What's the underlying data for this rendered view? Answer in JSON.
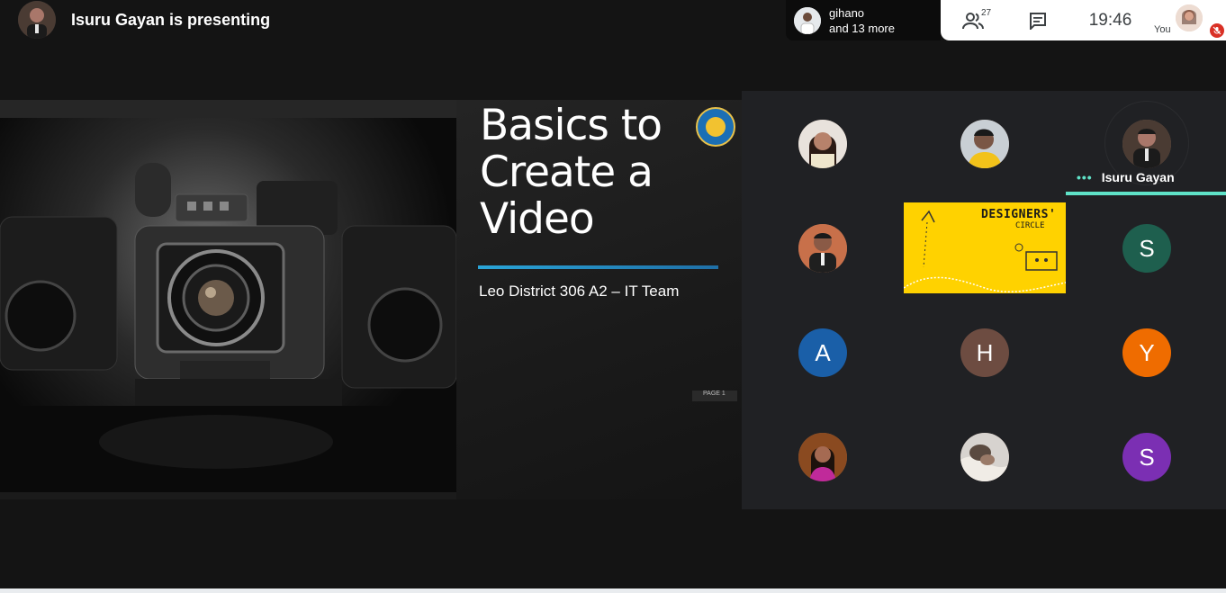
{
  "presenter": {
    "title": "Isuru Gayan is presenting"
  },
  "viewers": {
    "line1": "gihano",
    "line2": "and 13 more"
  },
  "controls": {
    "people_count": "27",
    "clock": "19:46",
    "self_label": "You"
  },
  "slide": {
    "title": "Basics to Create a Video",
    "subtitle": "Leo District 306 A2 – IT Team",
    "page": "PAGE 1"
  },
  "participants": {
    "active_speaker": "Isuru Gayan",
    "tile_designers_title": "DESIGNERS'",
    "tile_designers_sub": "CIRCLE",
    "initials": [
      "S",
      "A",
      "H",
      "Y",
      "S"
    ]
  },
  "colors": {
    "speaker_accent": "#5fe3c8",
    "initial_S_green": "#1e5f4e",
    "initial_A_blue": "#1a5fa8",
    "initial_H_brown": "#6d4c41",
    "initial_Y_orange": "#ef6c00",
    "initial_S_purple": "#7b2fb3",
    "mute_red": "#d93025"
  }
}
